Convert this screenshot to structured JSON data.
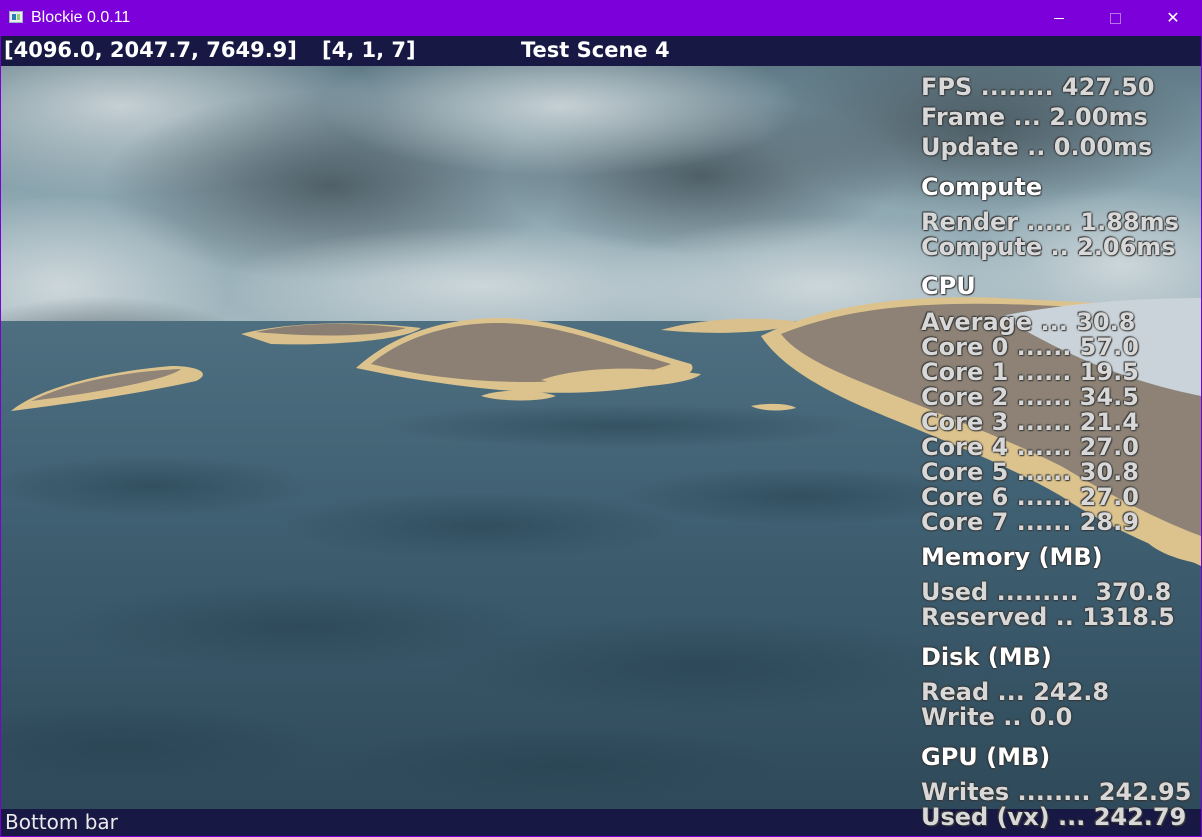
{
  "window": {
    "title": "Blockie 0.0.11",
    "icon": "app-icon",
    "controls": {
      "minimize_icon": "minimize-icon",
      "maximize_icon": "maximize-icon",
      "close_icon": "close-icon",
      "close_glyph": "✕"
    },
    "accent_color": "#7b00d9"
  },
  "topbar": {
    "coords": "[4096.0, 2047.7, 7649.9]",
    "chunk": "[4, 1, 7]",
    "scene": "Test Scene 4",
    "bg_color": "#181844"
  },
  "stats": {
    "fps": "FPS ........ 427.50",
    "frame": "Frame ... 2.00ms",
    "update": "Update .. 0.00ms",
    "compute_head": "Compute",
    "render": "Render ..... 1.88ms",
    "compute": "Compute .. 2.06ms",
    "cpu_head": "CPU",
    "cpu_average": "Average ... 30.8",
    "cores": [
      "Core 0 ...... 57.0",
      "Core 1 ...... 19.5",
      "Core 2 ...... 34.5",
      "Core 3 ...... 21.4",
      "Core 4 ...... 27.0",
      "Core 5 ...... 30.8",
      "Core 6 ...... 27.0",
      "Core 7 ...... 28.9"
    ],
    "memory_head": "Memory (MB)",
    "mem_used": "Used .........  370.8",
    "mem_reserved": "Reserved .. 1318.5",
    "disk_head": "Disk (MB)",
    "disk_read": "Read ... 242.8",
    "disk_write": "Write .. 0.0",
    "gpu_head": "GPU (MB)",
    "gpu_writes": "Writes ........ 242.95",
    "gpu_used_vx": "Used (vx) ... 242.79"
  },
  "bottombar": {
    "label": "Bottom bar"
  }
}
